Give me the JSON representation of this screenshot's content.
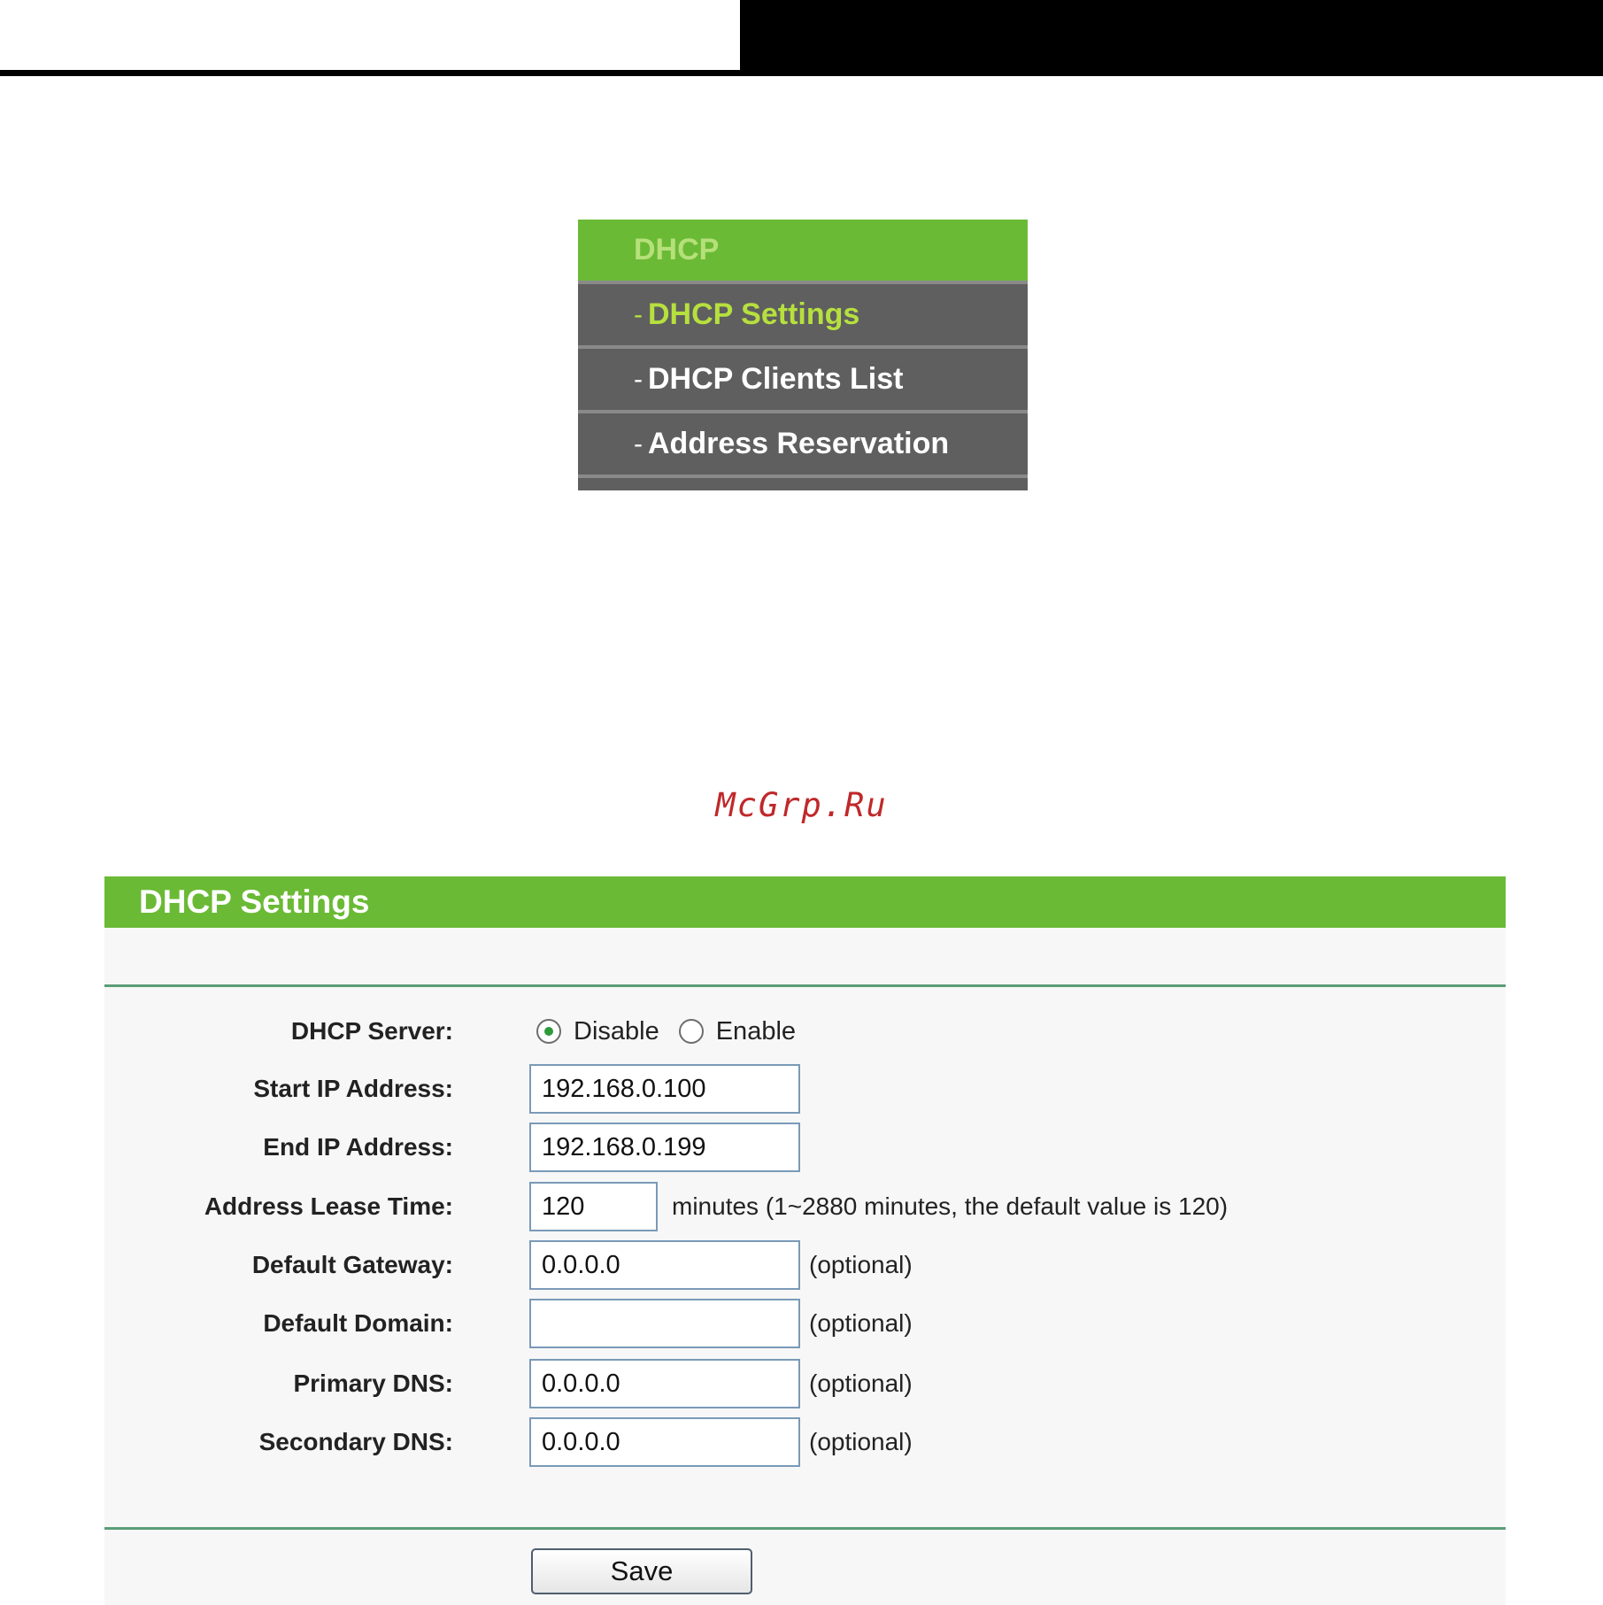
{
  "menu": {
    "title": "DHCP",
    "items": [
      {
        "dash": "-",
        "label": "DHCP Settings"
      },
      {
        "dash": "-",
        "label": "DHCP Clients List"
      },
      {
        "dash": "-",
        "label": "Address Reservation"
      }
    ],
    "active_index": 0
  },
  "watermark": "McGrp.Ru",
  "settings": {
    "header": "DHCP Settings",
    "dhcp_server_label": "DHCP Server:",
    "dhcp_server_options": [
      "Disable",
      "Enable"
    ],
    "dhcp_server_selected": "Disable",
    "start_ip_label": "Start IP Address:",
    "start_ip_value": "192.168.0.100",
    "end_ip_label": "End IP Address:",
    "end_ip_value": "192.168.0.199",
    "lease_label": "Address Lease Time:",
    "lease_value": "120",
    "lease_hint": "minutes (1~2880 minutes, the default value is 120)",
    "gateway_label": "Default Gateway:",
    "gateway_value": "0.0.0.0",
    "domain_label": "Default Domain:",
    "domain_value": "",
    "primary_dns_label": "Primary DNS:",
    "primary_dns_value": "0.0.0.0",
    "secondary_dns_label": "Secondary DNS:",
    "secondary_dns_value": "0.0.0.0",
    "optional_hint": "(optional)",
    "save_label": "Save"
  },
  "colors": {
    "accent_green": "#6aba35",
    "menu_grey": "#5f5f5f",
    "active_text": "#b6e03e",
    "divider_green": "#5b9d78",
    "watermark": "#c0282a"
  }
}
